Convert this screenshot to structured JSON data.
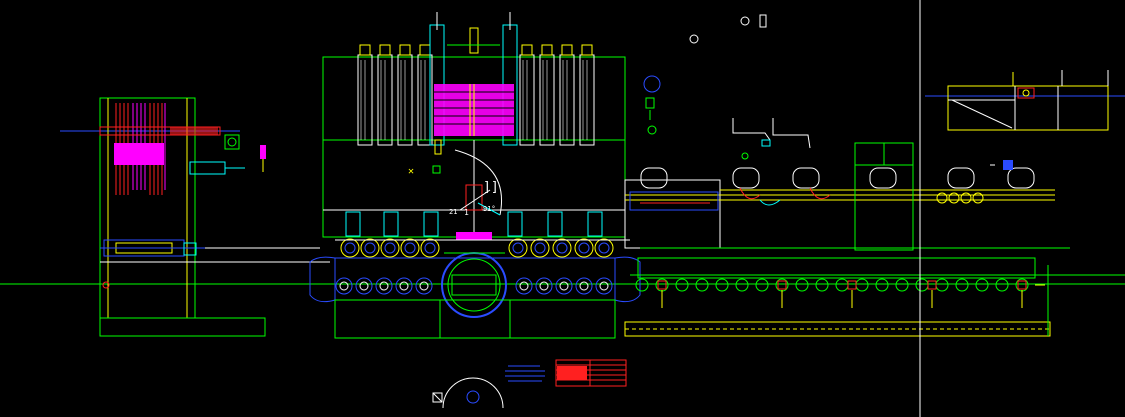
{
  "drawing": {
    "background": "#000000",
    "colors": {
      "green": "#00ff00",
      "yellow": "#ffff00",
      "white": "#ffffff",
      "cyan": "#00ffff",
      "magenta": "#ff00ff",
      "blue": "#2a4bff",
      "red": "#ff2020",
      "orange": "#ff8a00"
    },
    "labels": {
      "dim_a": "21",
      "dim_b": "1",
      "dim_c": "91°",
      "bracket_mark": "]]"
    },
    "cursor_crosshair": "crosshair-cursor"
  }
}
